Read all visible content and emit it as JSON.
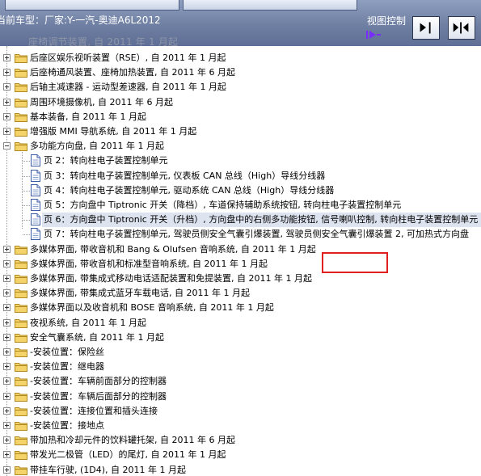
{
  "header": {
    "car_label": "当前车型：厂家:Y-一汽-奥迪A6L2012",
    "view_control_label": "视图控制",
    "ghost_row_text": "座椅调节装置, 自 2011 年 1 月起"
  },
  "tree": {
    "items": [
      {
        "type": "folder",
        "label": "后座区娱乐视听装置（RSE）, 自 2011 年 1 月起"
      },
      {
        "type": "folder",
        "label": "后座椅通风装置、座椅加热装置, 自 2011 年 6 月起"
      },
      {
        "type": "folder",
        "label": "后轴主减速器 - 运动型差速器, 自 2011 年 1 月起"
      },
      {
        "type": "folder",
        "label": "周围环境摄像机, 自 2011 年 6 月起"
      },
      {
        "type": "folder",
        "label": "基本装备, 自 2011 年 1 月起"
      },
      {
        "type": "folder",
        "label": "增强版 MMI 导航系统, 自 2011 年 1 月起"
      },
      {
        "type": "folder-open",
        "label": "多功能方向盘, 自 2011 年 1 月起"
      },
      {
        "type": "page",
        "label": "页 2：转向柱电子装置控制单元"
      },
      {
        "type": "page",
        "label": "页 3：转向柱电子装置控制单元, 仪表板 CAN 总线（High）导线分线器"
      },
      {
        "type": "page",
        "label": "页 4：转向柱电子装置控制单元, 驱动系统 CAN 总线（High）导线分线器"
      },
      {
        "type": "page",
        "label": "页 5：方向盘中 Tiptronic 开关（降档）, 车道保持辅助系统按钮, 转向柱电子装置控制单元"
      },
      {
        "type": "page",
        "label": "页 6：方向盘中 Tiptronic 开关（升档）, 方向盘中的右侧多功能按钮, 信号喇叭控制, 转向柱电子装置控制单元",
        "selected": true
      },
      {
        "type": "page",
        "label": "页 7：转向柱电子装置控制单元, 驾驶员侧安全气囊引爆装置, 驾驶员侧安全气囊引爆装置 2, 可加热式方向盘"
      },
      {
        "type": "folder",
        "label": "多媒体界面, 带收音机和 Bang & Olufsen 音响系统, 自 2011 年 1 月起"
      },
      {
        "type": "folder",
        "label": "多媒体界面, 带收音机和标准型音响系统, 自 2011 年 1 月起"
      },
      {
        "type": "folder",
        "label": "多媒体界面, 带集成式移动电话适配装置和免提装置, 自 2011 年 1 月起"
      },
      {
        "type": "folder",
        "label": "多媒体界面, 带集成式蓝牙车载电话, 自 2011 年 1 月起"
      },
      {
        "type": "folder",
        "label": "多媒体界面以及收音机和 BOSE 音响系统, 自 2011 年 1 月起"
      },
      {
        "type": "folder",
        "label": "夜视系统, 自 2011 年 1 月起"
      },
      {
        "type": "folder",
        "label": "安全气囊系统, 自 2011 年 1 月起"
      },
      {
        "type": "folder",
        "label": "-安装位置：保险丝"
      },
      {
        "type": "folder",
        "label": "-安装位置：继电器"
      },
      {
        "type": "folder",
        "label": "-安装位置：车辆前面部分的控制器"
      },
      {
        "type": "folder",
        "label": "-安装位置：车辆后面部分的控制器"
      },
      {
        "type": "folder",
        "label": "-安装位置：连接位置和插头连接"
      },
      {
        "type": "folder",
        "label": "-安装位置：接地点"
      },
      {
        "type": "folder",
        "label": "带加热和冷却元件的饮料罐托架, 自 2011 年 6 月起"
      },
      {
        "type": "folder",
        "label": "带发光二极管（LED）的尾灯, 自 2011 年 1 月起"
      },
      {
        "type": "folder",
        "label": "带挂车行驶, (1D4), 自 2011 年 1 月起"
      }
    ]
  },
  "colors": {
    "header_bg": "#6f7fa3",
    "selected_bg": "#dde3ef",
    "highlight_border": "#e02020",
    "folder_yellow": "#f3d36a"
  },
  "icons": [
    "folder-icon",
    "document-icon",
    "expand-plus-icon",
    "collapse-minus-icon",
    "dock-right-icon",
    "split-view-icon",
    "view-indicator-icon"
  ]
}
